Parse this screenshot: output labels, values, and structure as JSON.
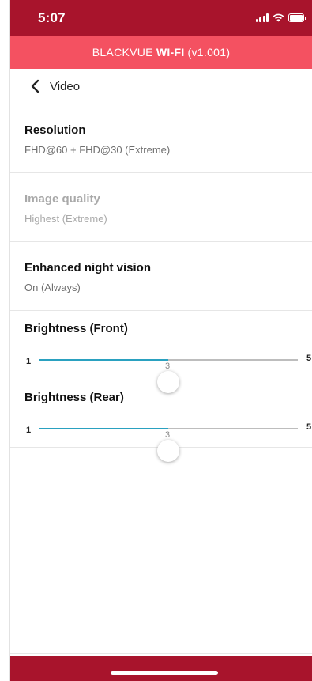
{
  "status_bar": {
    "time": "5:07",
    "icons": [
      "signal-icon",
      "wifi-icon",
      "battery-icon"
    ]
  },
  "app_header": {
    "brand": "BLACKVUE",
    "product": "WI-FI",
    "version": "(v1.001)"
  },
  "nav": {
    "back_icon": "chevron-left-icon",
    "title": "Video"
  },
  "settings": [
    {
      "title": "Resolution",
      "value": "FHD@60 + FHD@30 (Extreme)",
      "enabled": true
    },
    {
      "title": "Image quality",
      "value": "Highest (Extreme)",
      "enabled": false
    },
    {
      "title": "Enhanced night vision",
      "value": "On (Always)",
      "enabled": true
    }
  ],
  "sliders": [
    {
      "title": "Brightness (Front)",
      "min": "1",
      "max": "5",
      "value": "3",
      "fraction": 0.5
    },
    {
      "title": "Brightness (Rear)",
      "min": "1",
      "max": "5",
      "value": "3",
      "fraction": 0.5
    }
  ],
  "colors": {
    "status_bar": "#a8142c",
    "header": "#f45161",
    "slider_active": "#2aa1c0"
  }
}
